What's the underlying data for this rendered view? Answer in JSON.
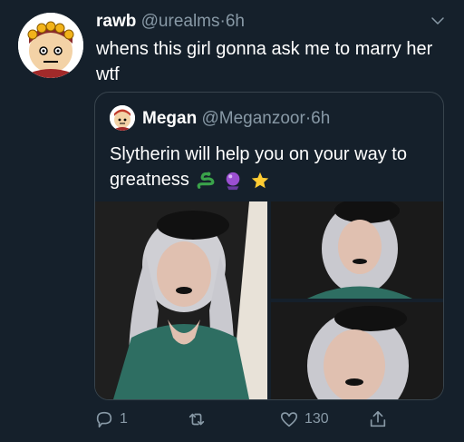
{
  "tweet": {
    "author_name": "rawb",
    "author_handle": "@urealms",
    "separator": "·",
    "time": "6h",
    "text": "whens this girl gonna ask me to marry her wtf"
  },
  "quoted_tweet": {
    "author_name": "Megan",
    "author_handle": "@Meganzoor",
    "separator": "·",
    "time": "6h",
    "text": "Slytherin will help you on your way to greatness",
    "emojis": [
      "snake-emoji",
      "crystal-ball-emoji",
      "star-emoji"
    ],
    "photos": [
      "photo-selfie-left",
      "photo-top-right",
      "photo-bottom-right"
    ]
  },
  "actions": {
    "reply_count": "1",
    "retweet_count": "",
    "like_count": "130"
  },
  "colors": {
    "background": "#15202b",
    "text": "#ffffff",
    "secondary": "#8899a6",
    "border": "#38444d"
  }
}
